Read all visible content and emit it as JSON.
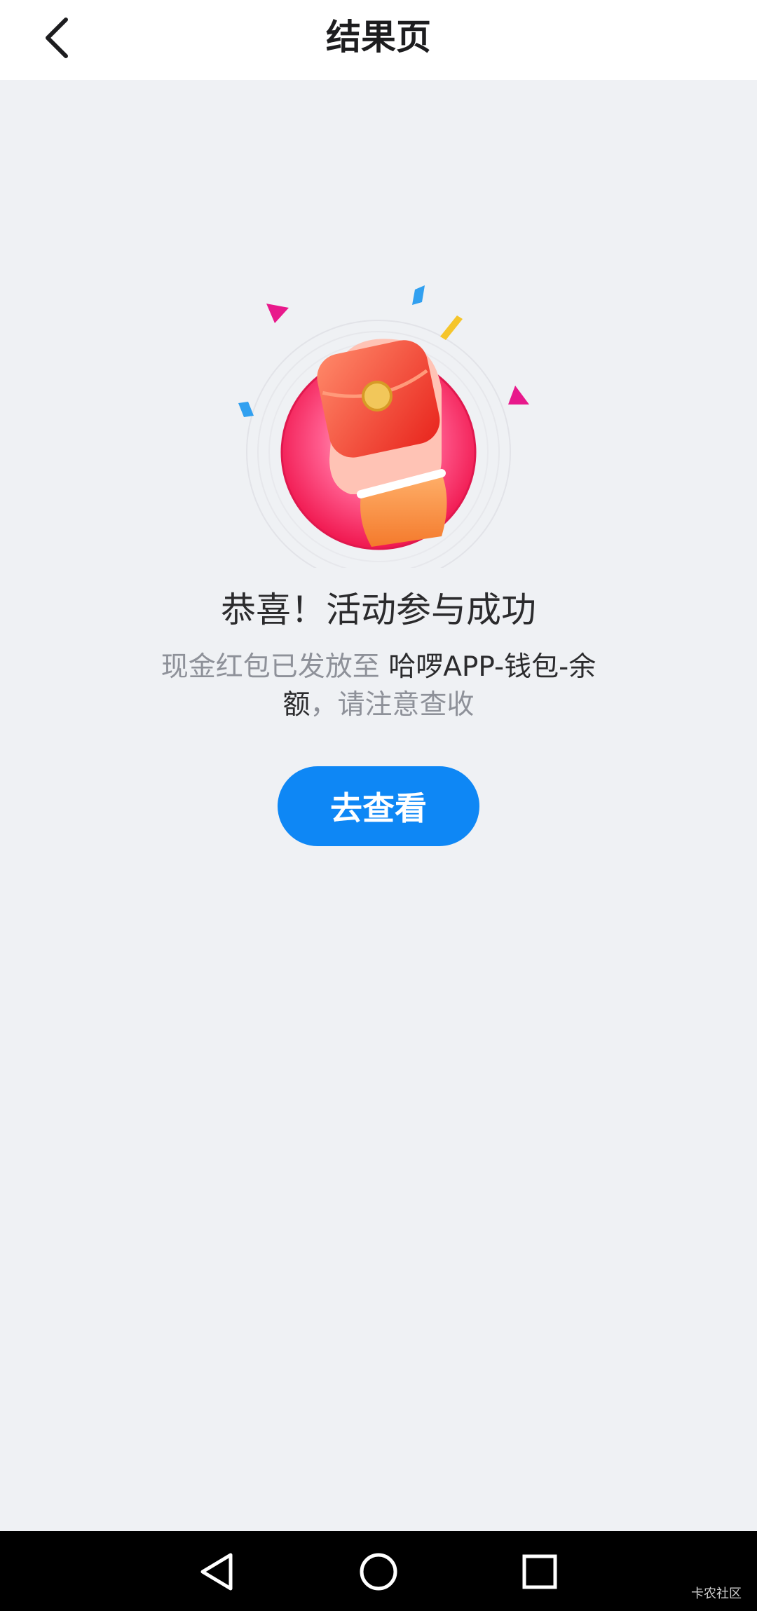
{
  "header": {
    "title": "结果页",
    "back_icon": "chevron-left-icon"
  },
  "hero": {
    "icon": "red-envelope-hand-icon"
  },
  "result": {
    "headline": "恭喜！活动参与成功",
    "desc_part1": "现金红包已发放至 ",
    "desc_part2": "哈啰APP-钱包-余额",
    "desc_part3": "，请注意查收"
  },
  "action": {
    "view_label": "去查看"
  },
  "navbar": {
    "back_icon": "triangle-back-icon",
    "home_icon": "circle-home-icon",
    "recents_icon": "square-recents-icon",
    "watermark": "卡农社区"
  },
  "colors": {
    "accent": "#0e87f5",
    "background": "#eff1f4",
    "header": "#ffffff",
    "text_gray": "#8e9199",
    "text_dark": "#2b2b2d"
  }
}
